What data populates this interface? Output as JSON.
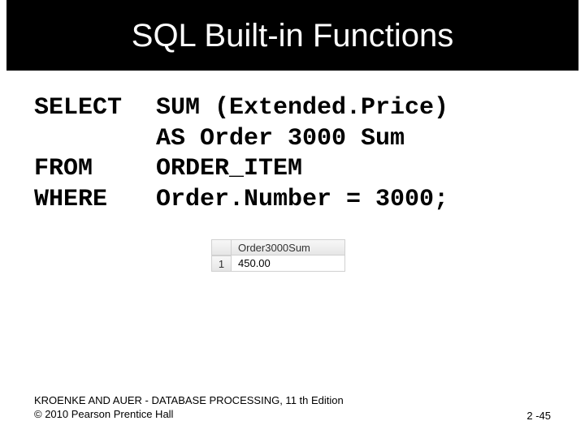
{
  "title": "SQL Built-in Functions",
  "sql": {
    "select_kw": "SELECT",
    "select_expr": "SUM (Extended.Price)",
    "as_line": "AS  Order 3000 Sum",
    "from_kw": "FROM",
    "from_expr": "ORDER_ITEM",
    "where_kw": "WHERE",
    "where_expr": "Order.Number = 3000;"
  },
  "result": {
    "header": "Order3000Sum",
    "row_index": "1",
    "value": "450.00"
  },
  "footer": {
    "line1": "KROENKE AND AUER - DATABASE PROCESSING, 11 th Edition",
    "line2": "© 2010 Pearson Prentice Hall",
    "page": "2 -45"
  }
}
